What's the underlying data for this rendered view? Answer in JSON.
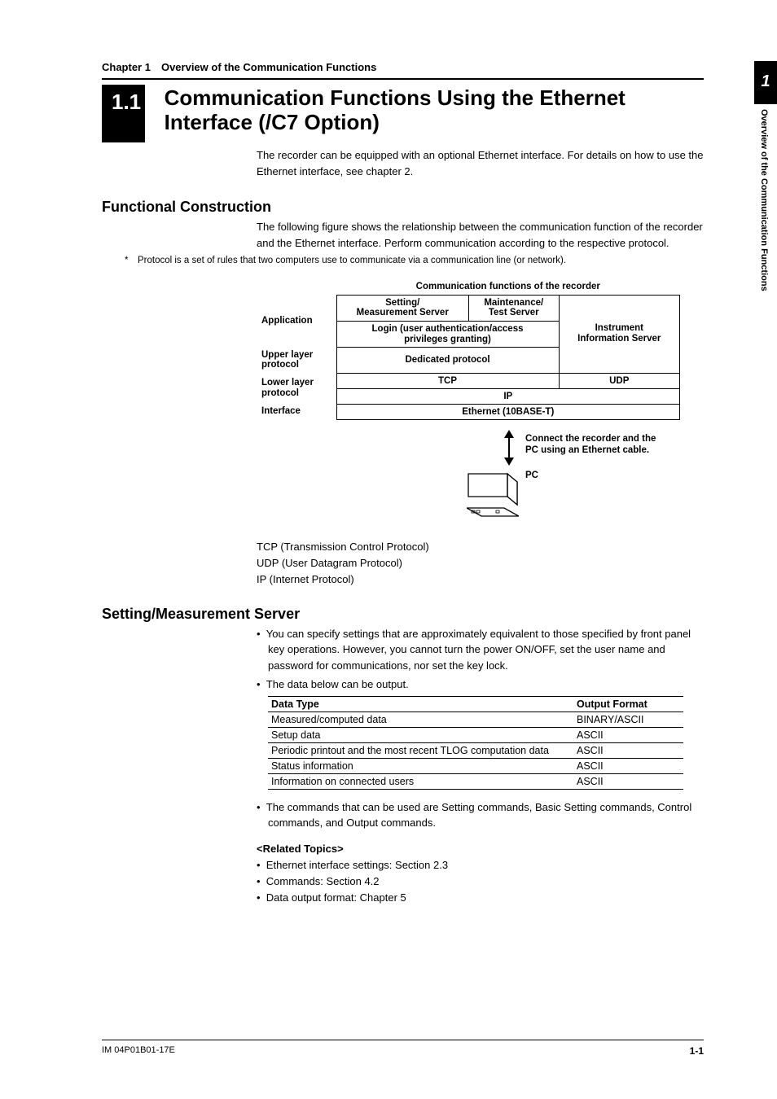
{
  "chapter_head": "Chapter 1 Overview of the Communication Functions",
  "section_num": "1.1",
  "section_title": "Communication Functions Using the Ethernet Interface (/C7 Option)",
  "intro": "The recorder can be equipped with an optional Ethernet interface. For details on how to use the Ethernet interface, see chapter 2.",
  "func": {
    "heading": "Functional Construction",
    "para": "The following figure shows the relationship between the communication function of the recorder and the Ethernet interface. Perform communication according to the respective protocol.",
    "footnote": "* Protocol is a set of rules that two computers use to communicate via a communication line (or network)."
  },
  "layer_table": {
    "super_head": "Communication functions of the recorder",
    "rows": {
      "app_label": "Application",
      "app_c1a": "Setting/",
      "app_c1b": "Measurement Server",
      "app_c2a": "Maintenance/",
      "app_c2b": "Test Server",
      "app_login1": "Login (user authentication/access",
      "app_login2": "privileges granting)",
      "app_c3a": "Instrument",
      "app_c3b": "Information Server",
      "upper_label1": "Upper layer",
      "upper_label2": "protocol",
      "upper_val": "Dedicated protocol",
      "lower_label1": "Lower layer",
      "lower_label2": "protocol",
      "tcp": "TCP",
      "udp": "UDP",
      "ip": "IP",
      "iface_label": "Interface",
      "iface_val": "Ethernet (10BASE-T)"
    }
  },
  "diagram": {
    "conn1": "Connect the recorder and the",
    "conn2": "PC using an Ethernet cable.",
    "pc": "PC"
  },
  "protocols": {
    "tcp": "TCP (Transmission Control Protocol)",
    "udp": "UDP (User Datagram Protocol)",
    "ip": "IP (Internet Protocol)"
  },
  "server": {
    "heading": "Setting/Measurement Server",
    "b1": "You can specify settings that are approximately equivalent to those specified by front panel key operations. However, you cannot turn the power ON/OFF, set the user name and password for communications, nor set the key lock.",
    "b2": "The data below can be output.",
    "b3": "The commands that can be used are Setting commands, Basic Setting commands, Control commands, and Output commands."
  },
  "data_table": {
    "h1": "Data Type",
    "h2": "Output Format",
    "rows": [
      [
        "Measured/computed data",
        "BINARY/ASCII"
      ],
      [
        "Setup data",
        "ASCII"
      ],
      [
        "Periodic printout and the most recent TLOG computation data",
        "ASCII"
      ],
      [
        "Status information",
        "ASCII"
      ],
      [
        "Information on connected users",
        "ASCII"
      ]
    ]
  },
  "related": {
    "heading": "<Related Topics>",
    "items": [
      "Ethernet interface settings: Section 2.3",
      "Commands: Section 4.2",
      "Data output format: Chapter 5"
    ]
  },
  "sidetab": {
    "num": "1",
    "text": "Overview of the Communication Functions"
  },
  "footer": {
    "left": "IM 04P01B01-17E",
    "right": "1-1"
  }
}
